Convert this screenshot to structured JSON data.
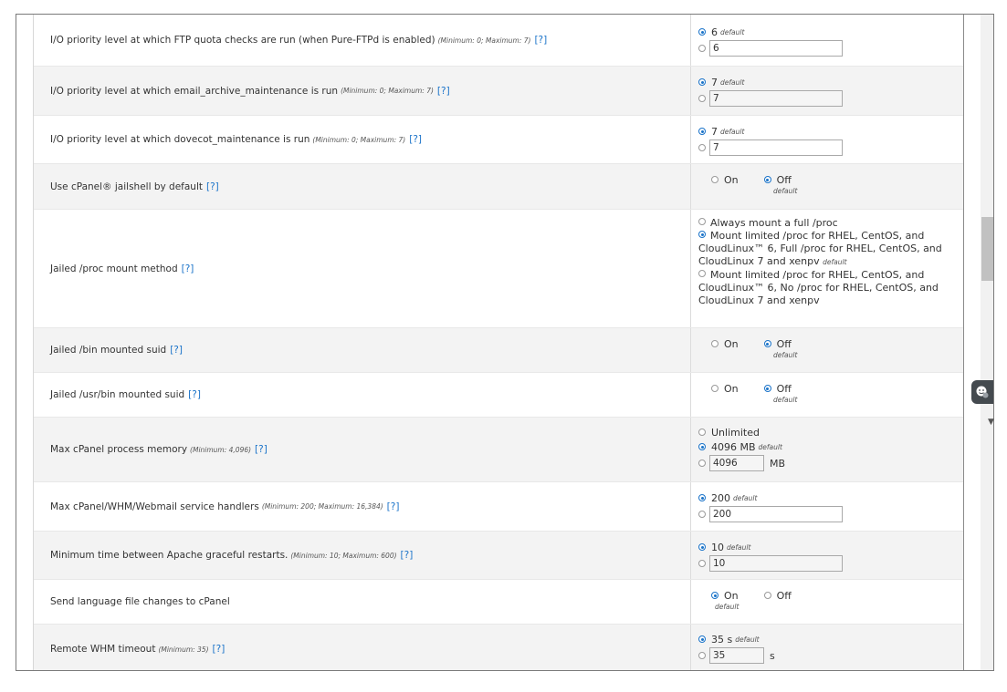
{
  "help_label": "[?]",
  "default_label": "default",
  "rows": [
    {
      "label": "I/O priority level at which FTP quota checks are run (when Pure-FTPd is enabled)",
      "limit": "(Minimum: 0; Maximum: 7)",
      "default_value": "6",
      "input_value": "6"
    },
    {
      "label": "I/O priority level at which email_archive_maintenance is run",
      "limit": "(Minimum: 0; Maximum: 7)",
      "default_value": "7",
      "input_value": "7"
    },
    {
      "label": "I/O priority level at which dovecot_maintenance is run",
      "limit": "(Minimum: 0; Maximum: 7)",
      "default_value": "7",
      "input_value": "7"
    },
    {
      "label": "Use cPanel® jailshell by default",
      "on_label": "On",
      "off_label": "Off"
    },
    {
      "label": "Jailed /proc mount method",
      "options": [
        "Always mount a full /proc",
        "Mount limited /proc for RHEL, CentOS, and CloudLinux™ 6, Full /proc for RHEL, CentOS, and CloudLinux 7 and xenpv",
        "Mount limited /proc for RHEL, CentOS, and CloudLinux™ 6, No /proc for RHEL, CentOS, and CloudLinux 7 and xenpv"
      ]
    },
    {
      "label": "Jailed /bin mounted suid",
      "on_label": "On",
      "off_label": "Off"
    },
    {
      "label": "Jailed /usr/bin mounted suid",
      "on_label": "On",
      "off_label": "Off"
    },
    {
      "label": "Max cPanel process memory",
      "limit": "(Minimum: 4,096)",
      "unlimited_label": "Unlimited",
      "default_value": "4096 MB",
      "input_value": "4096",
      "unit": "MB"
    },
    {
      "label": "Max cPanel/WHM/Webmail service handlers",
      "limit": "(Minimum: 200; Maximum: 16,384)",
      "default_value": "200",
      "input_value": "200"
    },
    {
      "label": "Minimum time between Apache graceful restarts.",
      "limit": "(Minimum: 10; Maximum: 600)",
      "default_value": "10",
      "input_value": "10"
    },
    {
      "label": "Send language file changes to cPanel",
      "on_label": "On",
      "off_label": "Off"
    },
    {
      "label": "Remote WHM timeout",
      "limit": "(Minimum: 35)",
      "default_value": "35 s",
      "input_value": "35",
      "unit": "s"
    }
  ],
  "colors": {
    "accent": "#1a73c9",
    "row_alt": "#f3f3f3"
  }
}
